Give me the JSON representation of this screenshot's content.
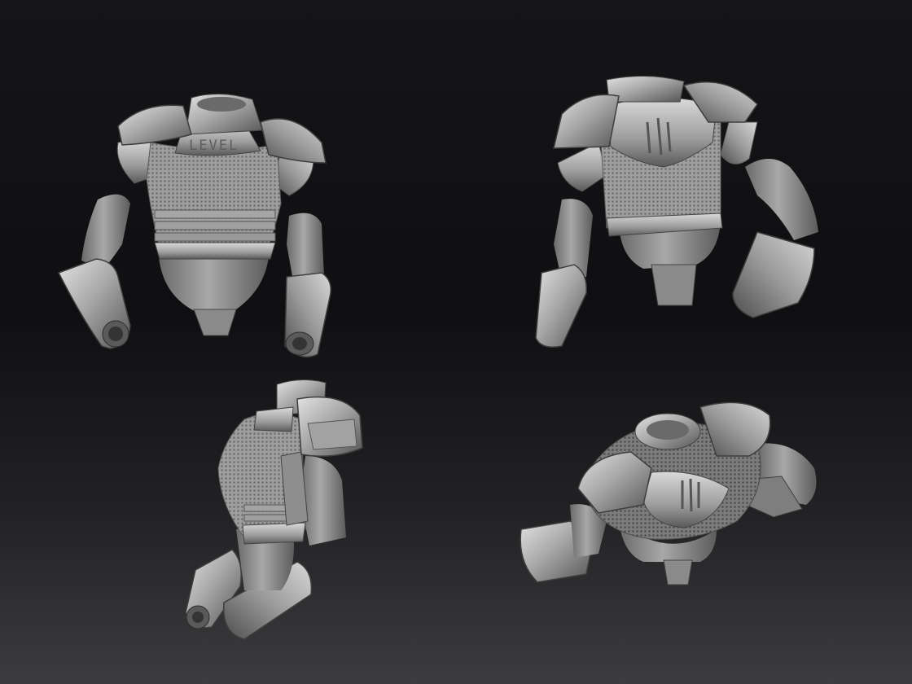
{
  "scene": {
    "background_top": "#141416",
    "background_bottom": "#3a3a3c",
    "clay_light": "#d8d8d8",
    "clay_mid": "#9a9a9a",
    "clay_dark": "#4e4e4e"
  },
  "views": [
    {
      "id": "front",
      "chest_engraving": "LEVEL"
    },
    {
      "id": "back"
    },
    {
      "id": "three-quarter"
    },
    {
      "id": "top-down"
    }
  ]
}
